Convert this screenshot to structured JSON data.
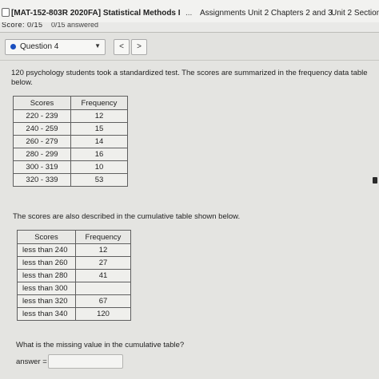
{
  "header": {
    "course_title": "[MAT-152-803R 2020FA] Statistical Methods I",
    "more": "...",
    "breadcrumb": "Assignments Unit 2 Chapters 2 and 3",
    "section": "Unit 2 Section"
  },
  "scoreline": {
    "score": "Score: 0/15",
    "answered": "0/15 answered"
  },
  "question_nav": {
    "selected": "Question 4",
    "prev_icon": "chevron-left-icon",
    "next_icon": "chevron-right-icon",
    "prev_glyph": "<",
    "next_glyph": ">",
    "caret_glyph": "▼",
    "status_color": "#1a4fbf"
  },
  "problem": {
    "intro": "120 psychology students took a standardized test. The scores are summarized in the frequency data table below.",
    "freq_headers": [
      "Scores",
      "Frequency"
    ],
    "freq_rows": [
      [
        "220 - 239",
        "12"
      ],
      [
        "240 - 259",
        "15"
      ],
      [
        "260 - 279",
        "14"
      ],
      [
        "280 - 299",
        "16"
      ],
      [
        "300 - 319",
        "10"
      ],
      [
        "320 - 339",
        "53"
      ]
    ],
    "cum_intro": "The scores are also described in the cumulative table shown below.",
    "cum_headers": [
      "Scores",
      "Frequency"
    ],
    "cum_rows": [
      [
        "less than 240",
        "12"
      ],
      [
        "less than 260",
        "27"
      ],
      [
        "less than 280",
        "41"
      ],
      [
        "less than 300",
        ""
      ],
      [
        "less than 320",
        "67"
      ],
      [
        "less than 340",
        "120"
      ]
    ],
    "question": "What is the missing value in the cumulative table?",
    "answer_label": "answer =",
    "answer_value": ""
  }
}
